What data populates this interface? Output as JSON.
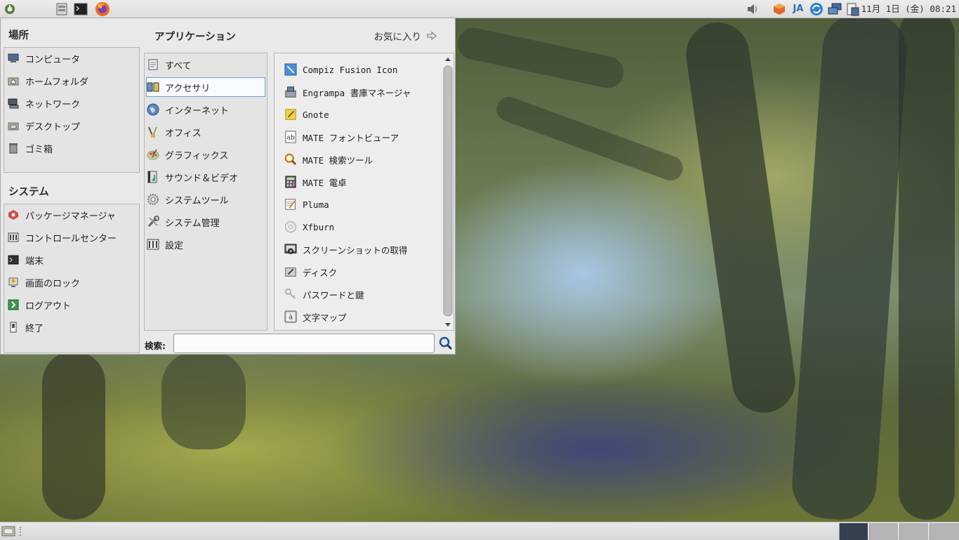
{
  "top_panel": {
    "launchers": [
      "menu-icon",
      "file-manager-icon",
      "terminal-icon",
      "firefox-icon"
    ],
    "tray": {
      "volume_icon": "volume-icon",
      "package_icon": "package-updates-icon",
      "input_method": "JA",
      "network_icons": [
        "sync-icon",
        "network-icon",
        "clipboard-icon"
      ]
    },
    "clock": "11月 1日 (金) 08:21"
  },
  "menu": {
    "places": {
      "title": "場所",
      "items": [
        {
          "label": "コンピュータ",
          "icon": "computer-icon"
        },
        {
          "label": "ホームフォルダ",
          "icon": "home-folder-icon"
        },
        {
          "label": "ネットワーク",
          "icon": "network-icon"
        },
        {
          "label": "デスクトップ",
          "icon": "desktop-icon"
        },
        {
          "label": "ゴミ箱",
          "icon": "trash-icon"
        }
      ]
    },
    "system": {
      "title": "システム",
      "items": [
        {
          "label": "パッケージマネージャ",
          "icon": "package-manager-icon"
        },
        {
          "label": "コントロールセンター",
          "icon": "control-center-icon"
        },
        {
          "label": "端末",
          "icon": "terminal-icon"
        },
        {
          "label": "画面のロック",
          "icon": "lock-screen-icon"
        },
        {
          "label": "ログアウト",
          "icon": "logout-icon"
        },
        {
          "label": "終了",
          "icon": "shutdown-icon"
        }
      ]
    },
    "applications": {
      "title": "アプリケーション",
      "favorites_label": "お気に入り",
      "categories": [
        {
          "label": "すべて",
          "icon": "all-apps-icon"
        },
        {
          "label": "アクセサリ",
          "icon": "accessories-icon",
          "selected": true
        },
        {
          "label": "インターネット",
          "icon": "internet-icon"
        },
        {
          "label": "オフィス",
          "icon": "office-icon"
        },
        {
          "label": "グラフィックス",
          "icon": "graphics-icon"
        },
        {
          "label": "サウンド＆ビデオ",
          "icon": "sound-video-icon"
        },
        {
          "label": "システムツール",
          "icon": "system-tools-icon"
        },
        {
          "label": "システム管理",
          "icon": "system-admin-icon"
        },
        {
          "label": "設定",
          "icon": "settings-icon"
        }
      ],
      "apps": [
        {
          "label": "Compiz Fusion Icon",
          "icon": "compiz-icon"
        },
        {
          "label": "Engrampa 書庫マネージャ",
          "icon": "archive-manager-icon"
        },
        {
          "label": "Gnote",
          "icon": "gnote-icon"
        },
        {
          "label": "MATE フォントビューア",
          "icon": "font-viewer-icon"
        },
        {
          "label": "MATE 検索ツール",
          "icon": "search-tool-icon"
        },
        {
          "label": "MATE 電卓",
          "icon": "calculator-icon"
        },
        {
          "label": "Pluma",
          "icon": "text-editor-icon"
        },
        {
          "label": "Xfburn",
          "icon": "disc-burner-icon"
        },
        {
          "label": "スクリーンショットの取得",
          "icon": "screenshot-icon"
        },
        {
          "label": "ディスク",
          "icon": "disks-icon"
        },
        {
          "label": "パスワードと鍵",
          "icon": "passwords-keys-icon"
        },
        {
          "label": "文字マップ",
          "icon": "character-map-icon"
        }
      ]
    },
    "search": {
      "label": "検索:",
      "value": "",
      "placeholder": ""
    }
  },
  "bottom_panel": {
    "show_desktop_icon": "show-desktop-icon",
    "workspaces": [
      "workspace-1",
      "workspace-2",
      "workspace-3",
      "workspace-4"
    ],
    "active_workspace": 1
  }
}
